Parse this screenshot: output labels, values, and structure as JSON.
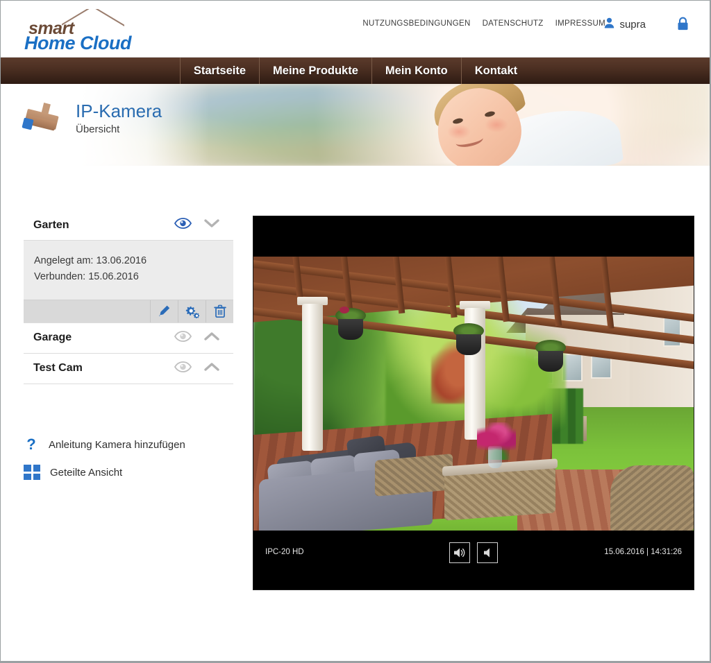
{
  "brand": {
    "smart": "smart",
    "home_cloud": "Home Cloud"
  },
  "header": {
    "links": [
      {
        "label": "NUTZUNGSBEDINGUNGEN"
      },
      {
        "label": "DATENSCHUTZ"
      },
      {
        "label": "IMPRESSUM"
      }
    ],
    "user": "supra",
    "user_icon": "person-icon",
    "lock_icon": "lock-icon"
  },
  "nav": {
    "items": [
      {
        "label": "Startseite"
      },
      {
        "label": "Meine Produkte"
      },
      {
        "label": "Mein Konto"
      },
      {
        "label": "Kontakt"
      }
    ]
  },
  "page": {
    "icon": "ip-camera-icon",
    "title": "IP-Kamera",
    "subtitle": "Übersicht"
  },
  "sidebar": {
    "cameras": [
      {
        "name": "Garten",
        "expanded": true,
        "visible": true,
        "eye_icon": "eye-icon",
        "chevron_icon": "chevron-down-icon",
        "created_label": "Angelegt am: 13.06.2016",
        "connected_label": "Verbunden: 15.06.2016",
        "actions": [
          {
            "name": "edit-camera-button",
            "icon": "pencil-icon"
          },
          {
            "name": "camera-settings-button",
            "icon": "gears-icon"
          },
          {
            "name": "delete-camera-button",
            "icon": "trash-icon"
          }
        ]
      },
      {
        "name": "Garage",
        "expanded": false,
        "visible": false,
        "eye_icon": "eye-icon",
        "chevron_icon": "chevron-up-icon"
      },
      {
        "name": "Test Cam",
        "expanded": false,
        "visible": false,
        "eye_icon": "eye-icon",
        "chevron_icon": "chevron-up-icon"
      }
    ],
    "links": [
      {
        "label": "Anleitung Kamera hinzufügen",
        "icon": "question-mark-icon"
      },
      {
        "label": "Geteilte Ansicht",
        "icon": "grid-view-icon"
      }
    ]
  },
  "player": {
    "model": "IPC-20 HD",
    "timestamp": "15.06.2016 | 14:31:26",
    "buttons": [
      {
        "name": "sound-on-button",
        "icon": "speaker-wave-icon"
      },
      {
        "name": "sound-off-button",
        "icon": "speaker-mute-icon"
      }
    ],
    "scene": "garden-patio-live-view"
  },
  "colors": {
    "accent_blue": "#2f76c9",
    "title_blue": "#2a6cb0",
    "nav_brown_top": "#5c3b2c",
    "nav_brown_bottom": "#2e1b13",
    "panel_grey": "#ececec",
    "action_bar_grey": "#d9d9d9"
  }
}
